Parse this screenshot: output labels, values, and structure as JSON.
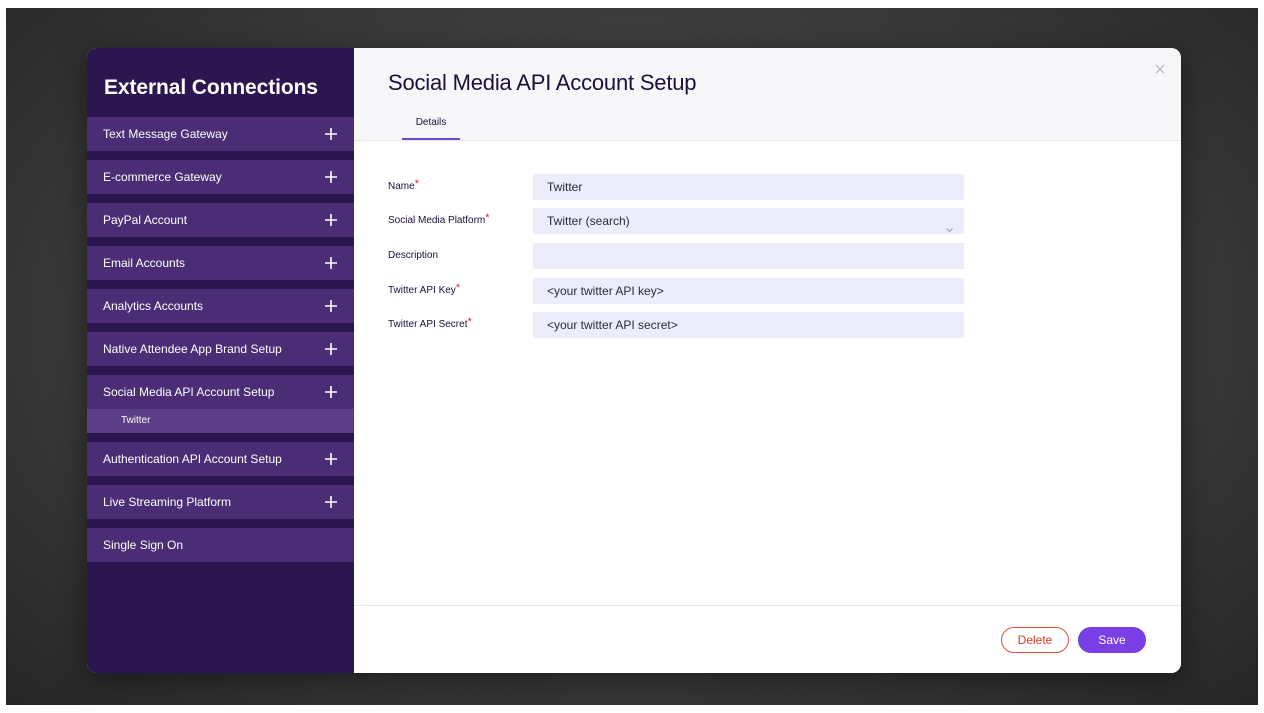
{
  "sidebar": {
    "title": "External Connections",
    "items": [
      {
        "label": "Text Message Gateway"
      },
      {
        "label": "E-commerce Gateway"
      },
      {
        "label": "PayPal Account"
      },
      {
        "label": "Email Accounts"
      },
      {
        "label": "Analytics Accounts"
      },
      {
        "label": "Native Attendee App Brand Setup"
      },
      {
        "label": "Social Media API Account Setup"
      },
      {
        "label": "Authentication API Account Setup"
      },
      {
        "label": "Live Streaming Platform"
      },
      {
        "label": "Single Sign On"
      }
    ],
    "sub_item": {
      "label": "Twitter"
    }
  },
  "main": {
    "title": "Social Media API Account Setup",
    "tabs": [
      {
        "label": "Details",
        "active": true
      }
    ],
    "form": {
      "name": {
        "label": "Name",
        "required": "*",
        "value": "Twitter"
      },
      "platform": {
        "label": "Social Media Platform",
        "required": "*",
        "value": "Twitter (search)"
      },
      "description": {
        "label": "Description",
        "value": ""
      },
      "api_key": {
        "label": "Twitter API Key",
        "required": "*",
        "value": "<your twitter API key>"
      },
      "api_secret": {
        "label": "Twitter API Secret",
        "required": "*",
        "value": "<your twitter API secret>"
      }
    },
    "footer": {
      "delete_label": "Delete",
      "save_label": "Save"
    }
  },
  "icons": {
    "plus": "plus-icon",
    "close": "close-icon",
    "chevron": "chevron-down-icon"
  },
  "colors": {
    "sidebar_bg": "#2b164f",
    "nav_item_bg": "#4a2d74",
    "active_sub_bg": "#5b3e86",
    "accent": "#7a3fe4",
    "delete": "#d93a28",
    "required": "#d9232e",
    "field_bg": "#ececfb"
  }
}
